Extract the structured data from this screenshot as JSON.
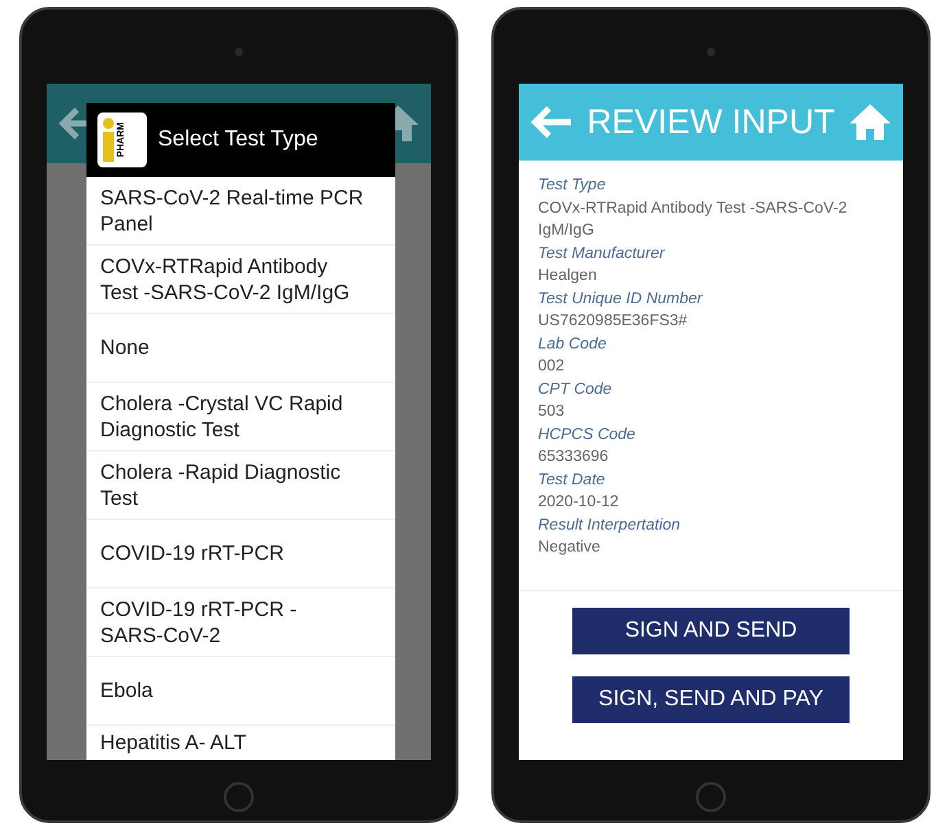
{
  "picker_screen": {
    "dialog": {
      "logo_text": "PHARM",
      "title": "Select Test Type",
      "options": [
        {
          "label": "SARS-CoV-2 Real-time PCR Panel"
        },
        {
          "label": "COVx-RTRapid Antibody Test -SARS-CoV-2 IgM/IgG"
        },
        {
          "label": "None"
        },
        {
          "label": "Cholera -Crystal VC Rapid Diagnostic Test"
        },
        {
          "label": "Cholera -Rapid Diagnostic Test"
        },
        {
          "label": "COVID-19 rRT-PCR"
        },
        {
          "label": "COVID-19 rRT-PCR - SARS-CoV-2"
        },
        {
          "label": "Ebola"
        },
        {
          "label": "Hepatitis A- ALT"
        }
      ]
    }
  },
  "review_screen": {
    "header": {
      "title": "REVIEW INPUT"
    },
    "fields": [
      {
        "label": "Test Type",
        "value": "COVx-RTRapid Antibody Test -SARS-CoV-2 IgM/IgG"
      },
      {
        "label": "Test Manufacturer",
        "value": "Healgen"
      },
      {
        "label": "Test Unique ID Number",
        "value": "US7620985E36FS3#"
      },
      {
        "label": "Lab Code",
        "value": "002"
      },
      {
        "label": "CPT Code",
        "value": "503"
      },
      {
        "label": "HCPCS Code",
        "value": "65333696"
      },
      {
        "label": "Test Date",
        "value": "2020-10-12"
      },
      {
        "label": "Result Interpertation",
        "value": "Negative"
      }
    ],
    "buttons": [
      {
        "label": "SIGN AND SEND"
      },
      {
        "label": "SIGN, SEND AND PAY"
      }
    ]
  }
}
